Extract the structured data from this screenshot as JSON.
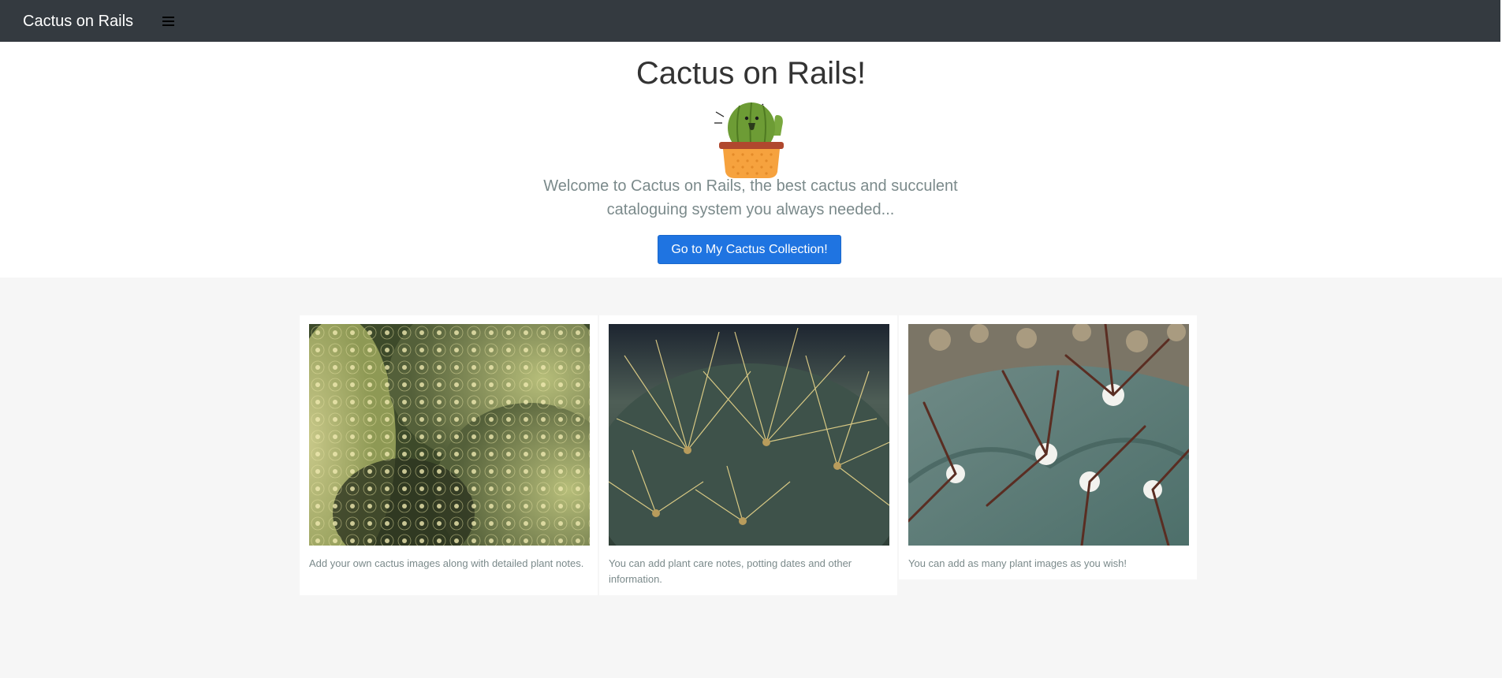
{
  "navbar": {
    "brand": "Cactus on Rails",
    "menu_icon": "hamburger-menu-icon"
  },
  "hero": {
    "title": "Cactus on Rails!",
    "logo_icon": "cactus-logo",
    "lead": "Welcome to Cactus on Rails, the best cactus and succulent cataloguing system you always needed...",
    "cta_label": "Go to My Cactus Collection!"
  },
  "features": [
    {
      "caption": "Add your own cactus images along with detailed plant notes."
    },
    {
      "caption": "You can add plant care notes, potting dates and other information."
    },
    {
      "caption": "You can add as many plant images as you wish!"
    }
  ],
  "colors": {
    "navbar_bg": "#343a40",
    "primary": "#1f74e1",
    "muted_text": "#7b8a8b",
    "features_bg": "#f6f6f6"
  }
}
